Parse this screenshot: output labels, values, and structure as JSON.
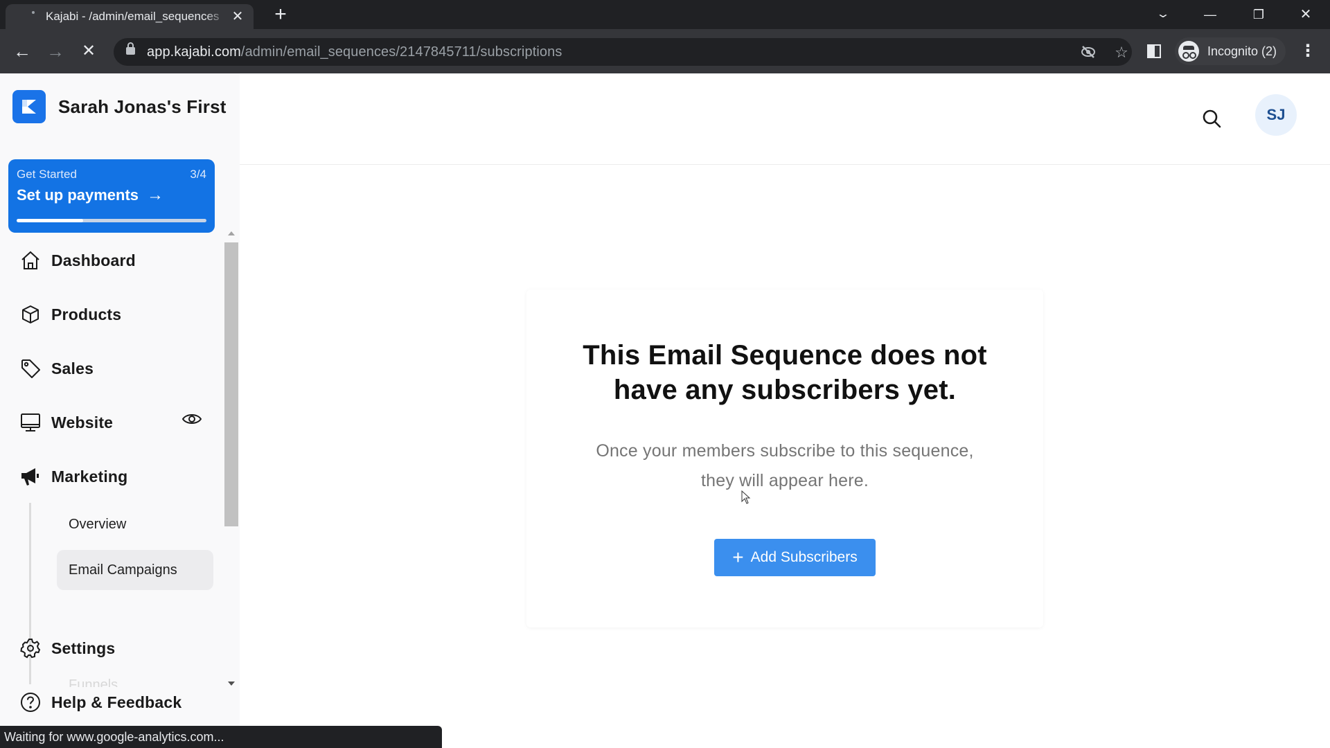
{
  "browser": {
    "tab_title": "Kajabi - /admin/email_sequences",
    "url_domain": "app.kajabi.com",
    "url_path": "/admin/email_sequences/2147845711/subscriptions",
    "profile_label": "Incognito (2)",
    "status_text": "Waiting for www.google-analytics.com...",
    "icons": {
      "back": "←",
      "forward": "→",
      "stop": "✕",
      "new_tab": "+",
      "tab_close": "✕",
      "tab_search": "⌄",
      "minimize": "—",
      "restore": "❐",
      "close": "✕",
      "tracking_blocked": "◎",
      "bookmark": "☆",
      "menu": "⋮"
    }
  },
  "sidebar": {
    "brand_name": "Sarah Jonas's First",
    "get_started": {
      "label": "Get Started",
      "count": "3/4",
      "title": "Set up payments",
      "arrow": "→",
      "progress_percent": 35
    },
    "nav": [
      {
        "id": "dashboard",
        "label": "Dashboard",
        "icon": "home-icon"
      },
      {
        "id": "products",
        "label": "Products",
        "icon": "box-icon"
      },
      {
        "id": "sales",
        "label": "Sales",
        "icon": "tag-icon"
      },
      {
        "id": "website",
        "label": "Website",
        "icon": "monitor-icon"
      },
      {
        "id": "marketing",
        "label": "Marketing",
        "icon": "megaphone-icon"
      }
    ],
    "marketing_subnav": [
      {
        "label": "Overview",
        "active": false
      },
      {
        "label": "Email Campaigns",
        "active": true
      },
      {
        "label": "Funnels",
        "active": false
      }
    ],
    "footer_nav": [
      {
        "id": "settings",
        "label": "Settings",
        "icon": "gear-icon"
      },
      {
        "id": "help",
        "label": "Help & Feedback",
        "icon": "help-icon"
      }
    ]
  },
  "header": {
    "avatar_initials": "SJ"
  },
  "empty_state": {
    "title_line1": "This Email Sequence does not",
    "title_line2": "have any subscribers yet.",
    "subtitle_line1": "Once your members subscribe to this sequence,",
    "subtitle_line2": "they will appear here.",
    "button_label": "Add Subscribers",
    "button_icon": "+"
  },
  "colors": {
    "brand": "#1373e4",
    "button": "#3b8fee",
    "avatar_bg": "#e8f1fc",
    "avatar_text": "#1d4f91"
  }
}
